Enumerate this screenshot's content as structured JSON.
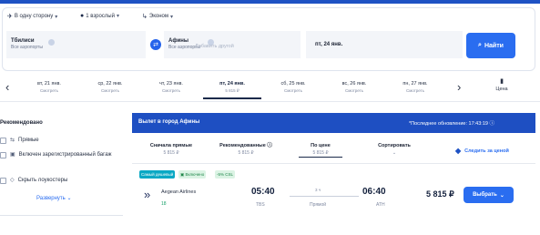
{
  "search": {
    "trip_type": "В одну сторону",
    "passengers": "1 взрослый",
    "cabin_class": "Эконом",
    "from": {
      "city": "Тбилиси",
      "airports": "Все аэропорты"
    },
    "to": {
      "city": "Афины",
      "airports": "Все аэропорты"
    },
    "add_other": "Добавить другой",
    "date": "пт, 24 янв.",
    "find_button": "Найти"
  },
  "dates": [
    {
      "label": "вт, 21 янв.",
      "sub": "Смотреть"
    },
    {
      "label": "ср, 22 янв.",
      "sub": "Смотреть"
    },
    {
      "label": "чт, 23 янв.",
      "sub": "Смотреть"
    },
    {
      "label": "пт, 24 янв.",
      "sub": "5 815 ₽",
      "active": true
    },
    {
      "label": "сб, 25 янв.",
      "sub": "Смотреть"
    },
    {
      "label": "вс, 26 янв.",
      "sub": "Смотреть"
    },
    {
      "label": "пн, 27 янв.",
      "sub": "Смотреть"
    }
  ],
  "price_chart_label": "Цена",
  "sidebar": {
    "title": "Рекомендовано",
    "filters": [
      {
        "label": "Прямые",
        "icon": "direct-route-icon"
      },
      {
        "label": "Включен зарегистрированный багаж",
        "icon": "baggage-icon"
      },
      {
        "label": "Скрыть лоукостеры",
        "icon": "tag-icon"
      }
    ],
    "expand": "Развернуть"
  },
  "results": {
    "title": "Вылет в город Афины",
    "last_update": "*Последнее обновление: 17:43:19",
    "sort_tabs": [
      {
        "label": "Сначала прямые",
        "price": "5 815 ₽"
      },
      {
        "label": "Рекомендованные",
        "price": "5 815 ₽"
      },
      {
        "label": "По цене",
        "price": "5 815 ₽",
        "active": true
      },
      {
        "label": "Сортировать",
        "price": ""
      }
    ],
    "follow_price": "Следить за ценой"
  },
  "flight": {
    "badges": [
      "Самый дешевый",
      "Включено",
      "-5% CSL"
    ],
    "airline": "Aegean Airlines",
    "airline_code": "18",
    "depart_time": "05:40",
    "depart_code": "TBS",
    "duration": "3 ч",
    "stops": "Прямой",
    "arrive_time": "06:40",
    "arrive_code": "ATH",
    "price": "5 815 ₽",
    "select_button": "Выбрать"
  },
  "colors": {
    "accent": "#2a6df0",
    "header": "#1e4fc2",
    "badge_cyan": "#0aa8c4",
    "badge_green": "#dbf3e4"
  }
}
